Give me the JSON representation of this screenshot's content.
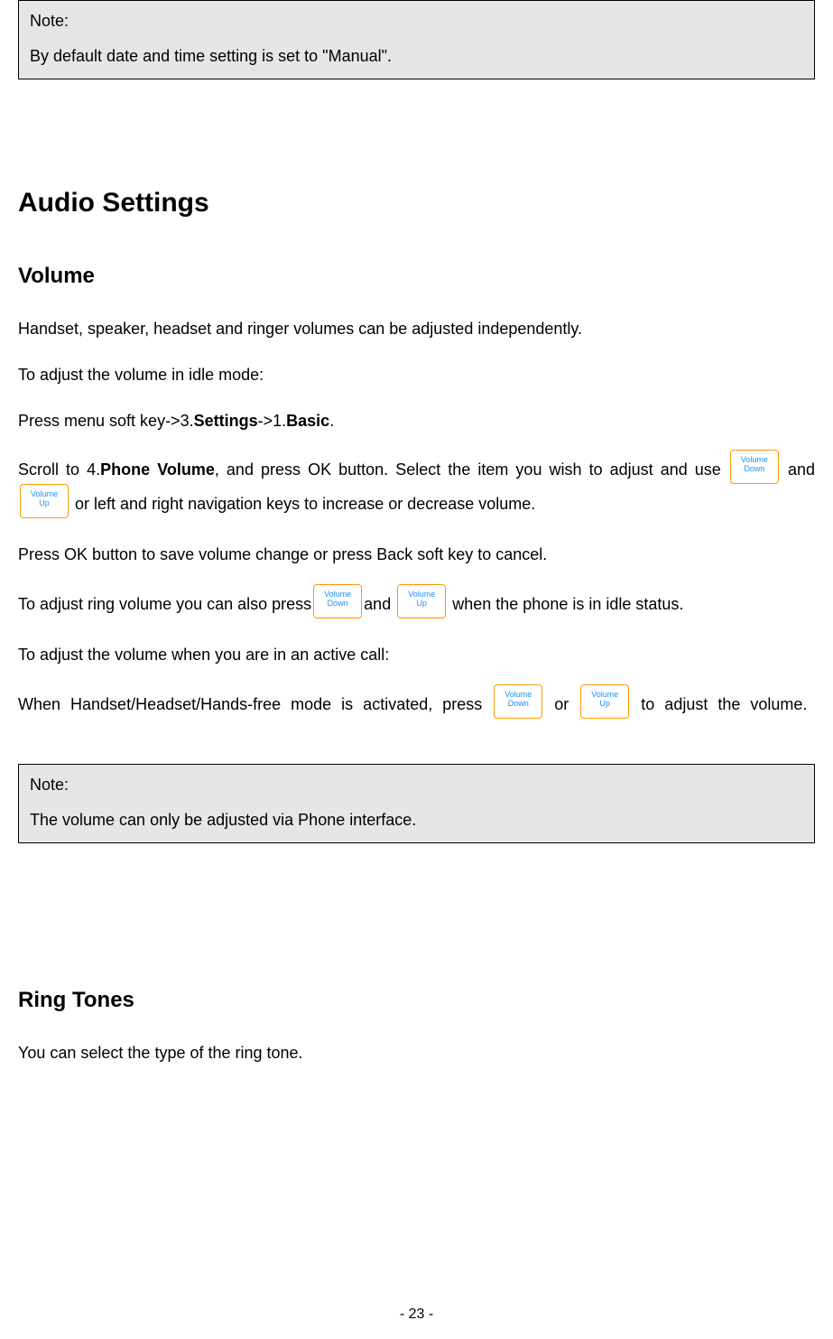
{
  "note1": {
    "title": "Note:",
    "body": "By default date and time setting is set to \"Manual\"."
  },
  "heading_audio": "Audio Settings",
  "subheading_volume": "Volume",
  "p_intro": "Handset, speaker, headset and ringer volumes can be adjusted independently.",
  "p_idle_label": "To adjust the volume in idle mode:",
  "path_line": {
    "pre": "Press menu soft key->3.",
    "settings": "Settings",
    "mid": "->1.",
    "basic": "Basic",
    "dot": "."
  },
  "scroll_line": {
    "pre": "Scroll to 4.",
    "phone_volume": "Phone Volume",
    "after": ", and press OK button. Select the item you wish to adjust and use ",
    "and": " and ",
    "rest": " or left and right navigation keys to increase or decrease volume."
  },
  "p_ok": "Press OK button to save volume change or press Back soft key to cancel.",
  "ring_line": {
    "pre": "To adjust ring volume you can also press",
    "and": "and ",
    "rest": " when the phone is in idle status."
  },
  "p_active_label": "To adjust the volume when you are in an active call:",
  "active_line": {
    "pre": "When Handset/Headset/Hands-free mode is activated, press ",
    "or": " or ",
    "rest": " to adjust the volume."
  },
  "note2": {
    "title": "Note:",
    "body": "The volume can only be adjusted via Phone interface."
  },
  "subheading_ring": "Ring Tones",
  "p_ring": "You can select the type of the ring tone.",
  "buttons": {
    "vol_down": "Volume\nDown",
    "vol_up": "Volume\nUp"
  },
  "page_number": "- 23 -"
}
